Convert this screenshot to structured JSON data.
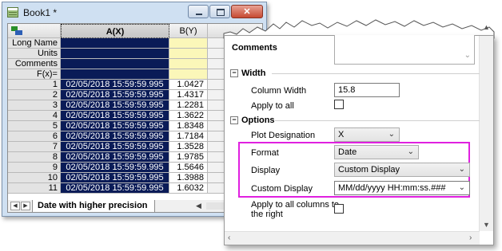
{
  "book": {
    "title": "Book1 *",
    "column_headers": [
      "A(X)",
      "B(Y)"
    ],
    "label_rows": [
      "Long Name",
      "Units",
      "Comments",
      "F(x)="
    ],
    "rows": [
      {
        "n": "1",
        "a": "02/05/2018 15:59:59.995",
        "b": "1.0427"
      },
      {
        "n": "2",
        "a": "02/05/2018 15:59:59.995",
        "b": "1.4317"
      },
      {
        "n": "3",
        "a": "02/05/2018 15:59:59.995",
        "b": "1.2281"
      },
      {
        "n": "4",
        "a": "02/05/2018 15:59:59.995",
        "b": "1.3622"
      },
      {
        "n": "5",
        "a": "02/05/2018 15:59:59.995",
        "b": "1.8348"
      },
      {
        "n": "6",
        "a": "02/05/2018 15:59:59.995",
        "b": "1.7184"
      },
      {
        "n": "7",
        "a": "02/05/2018 15:59:59.995",
        "b": "1.3528"
      },
      {
        "n": "8",
        "a": "02/05/2018 15:59:59.995",
        "b": "1.9785"
      },
      {
        "n": "9",
        "a": "02/05/2018 15:59:59.995",
        "b": "1.5646"
      },
      {
        "n": "10",
        "a": "02/05/2018 15:59:59.995",
        "b": "1.3988"
      },
      {
        "n": "11",
        "a": "02/05/2018 15:59:59.995",
        "b": "1.6032"
      }
    ],
    "sheet_tab": "Date with higher precision"
  },
  "panel": {
    "comments_label": "Comments",
    "width_section": "Width",
    "column_width_label": "Column Width",
    "column_width_value": "15.8",
    "apply_to_all_label": "Apply to all",
    "options_section": "Options",
    "plot_designation_label": "Plot Designation",
    "plot_designation_value": "X",
    "format_label": "Format",
    "format_value": "Date",
    "display_label": "Display",
    "display_value": "Custom Display",
    "custom_display_label": "Custom Display",
    "custom_display_value": "MM/dd/yyyy HH:mm:ss.###",
    "apply_right_label_1": "Apply to all columns to",
    "apply_right_label_2": "the right"
  },
  "colors": {
    "highlight": "#e020e0",
    "selection": "#0a1b57",
    "label_cell": "#fbf7b9"
  }
}
